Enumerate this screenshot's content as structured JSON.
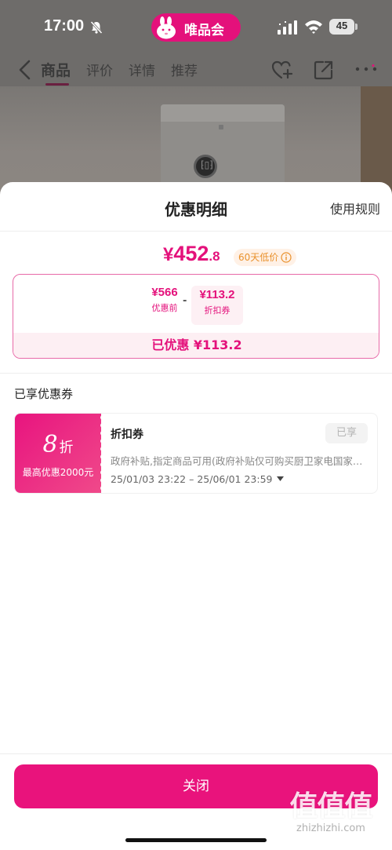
{
  "status_bar": {
    "time": "17:00",
    "battery": "45",
    "brand": "唯品会"
  },
  "nav": {
    "tabs": [
      "商品",
      "评价",
      "详情",
      "推荐"
    ],
    "active_tab": "商品"
  },
  "background_product": {
    "knob_text": "⁅▯⁆"
  },
  "sheet": {
    "title": "优惠明细",
    "rules_link": "使用规则",
    "final_price": {
      "currency": "¥",
      "integer": "452",
      "decimal": ".8"
    },
    "low_badge": "60天低价",
    "calc": {
      "original_amount": "¥566",
      "original_label": "优惠前",
      "minus_sign": "-",
      "coupon_amount": "¥113.2",
      "coupon_label": "折扣券"
    },
    "saved_text": "已优惠 ¥113.2",
    "section_label": "已享优惠券",
    "coupon": {
      "discount_value": "8",
      "discount_unit": "折",
      "cap_text": "最高优惠2000元",
      "name": "折扣券",
      "status": "已享",
      "description": "政府补贴,指定商品可用(政府补贴仅可购买厨卫家电国家一级能效产品)",
      "period": "25/01/03 23:22 – 25/06/01 23:59"
    },
    "close_button": "关闭"
  },
  "watermark": {
    "glyphs": "值值值",
    "site": "zhizhizhi.com"
  },
  "colors": {
    "brand_pink": "#e4117b",
    "badge_orange": "#e9912c",
    "coupon_gradient_start": "#e8147f",
    "coupon_gradient_end": "#f04a8a"
  }
}
